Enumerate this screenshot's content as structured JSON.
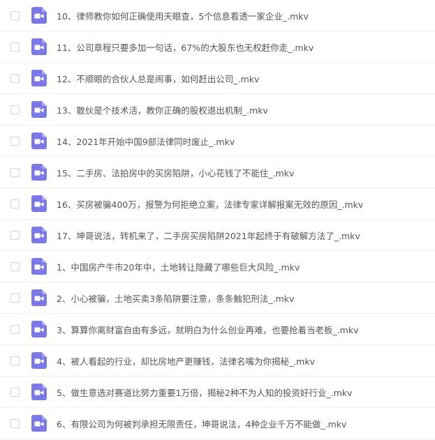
{
  "colors": {
    "icon_fill": "#7B78E8",
    "text": "#555555",
    "divider": "#efefef",
    "checkbox_border": "#d3d3d3"
  },
  "icon_name": "video-file-icon",
  "files": [
    {
      "name": "10、律师教你如何正确使用天眼查，5个信息看透一家企业_.mkv"
    },
    {
      "name": "11、公司章程只要多加一句话，67%的大股东也无权赶你走_.mkv"
    },
    {
      "name": "12、不顺眼的合伙人总是闹事，如何赶出公司_.mkv"
    },
    {
      "name": "13、散伙是个技术活，教你正确的股权退出机制_.mkv"
    },
    {
      "name": "14、2021年开始中国9部法律同时废止_.mkv"
    },
    {
      "name": "15、二手房、法拍房中的买房陷阱，小心花钱了不能住_.mkv"
    },
    {
      "name": "16、买房被骗400万，报警为何拒绝立案，法律专家详解报案无效的原因_.mkv"
    },
    {
      "name": "17、坤哥说法，转机来了，二手房买房陷阱2021年起终于有破解方法了_.mkv"
    },
    {
      "name": "1、中国房产牛市20年中，土地转让隐藏了哪些巨大风险_.mkv"
    },
    {
      "name": "2、小心被骗，土地买卖3条陷阱要注意，条条触犯刑法_.mkv"
    },
    {
      "name": "3、算算你离财富自由有多远，就明白为什么创业再难，也要抢着当老板_.mkv"
    },
    {
      "name": "4、被人看起的行业，却比房地产更赚钱，法律名嘴为你揭秘_.mkv"
    },
    {
      "name": "5、做生意选对赛道比努力重要1万倍，揭秘2种不为人知的投资好行业_.mkv"
    },
    {
      "name": "6、有限公司为何被判承担无限责任，坤哥说法，4种企业千万不能做_.mkv"
    }
  ]
}
